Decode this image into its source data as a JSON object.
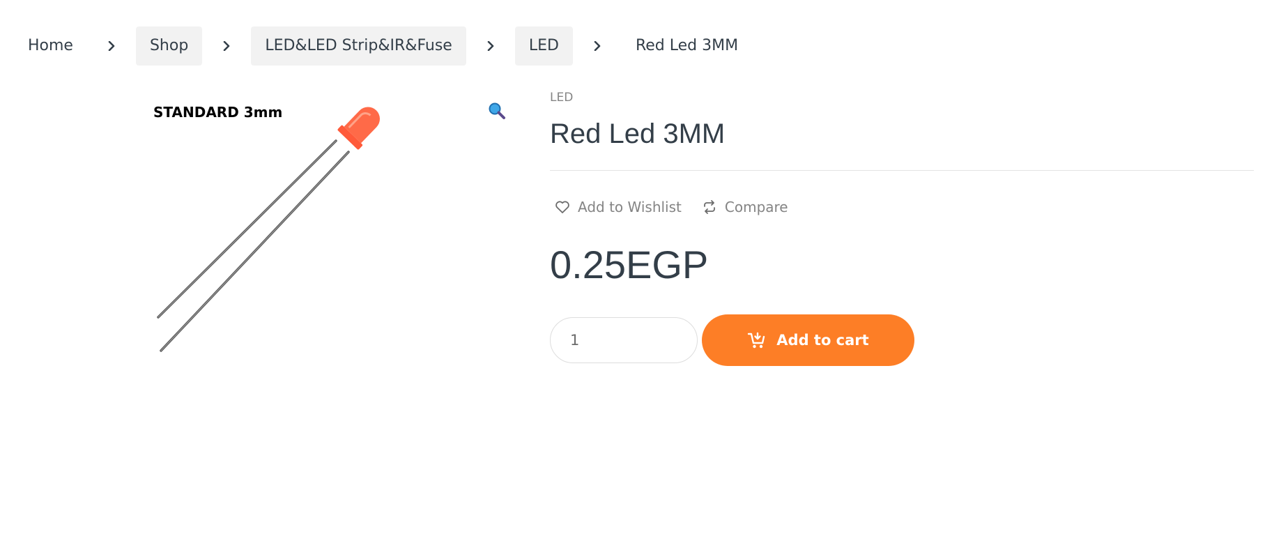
{
  "breadcrumb": {
    "items": [
      {
        "label": "Home"
      },
      {
        "label": "Shop"
      },
      {
        "label": "LED&LED Strip&IR&Fuse"
      },
      {
        "label": "LED"
      },
      {
        "label": "Red Led 3MM"
      }
    ]
  },
  "gallery": {
    "image_caption": "STANDARD 3mm",
    "zoom_icon": "magnifier-icon"
  },
  "product": {
    "category": "LED",
    "title": "Red Led 3MM",
    "wishlist_label": "Add to Wishlist",
    "compare_label": "Compare",
    "price": "0.25EGP",
    "quantity": "1",
    "add_to_cart_label": "Add to cart"
  },
  "colors": {
    "accent": "#fd7e26",
    "text": "#333e48",
    "muted": "#848484",
    "crumb_bg": "#f2f2f2"
  }
}
